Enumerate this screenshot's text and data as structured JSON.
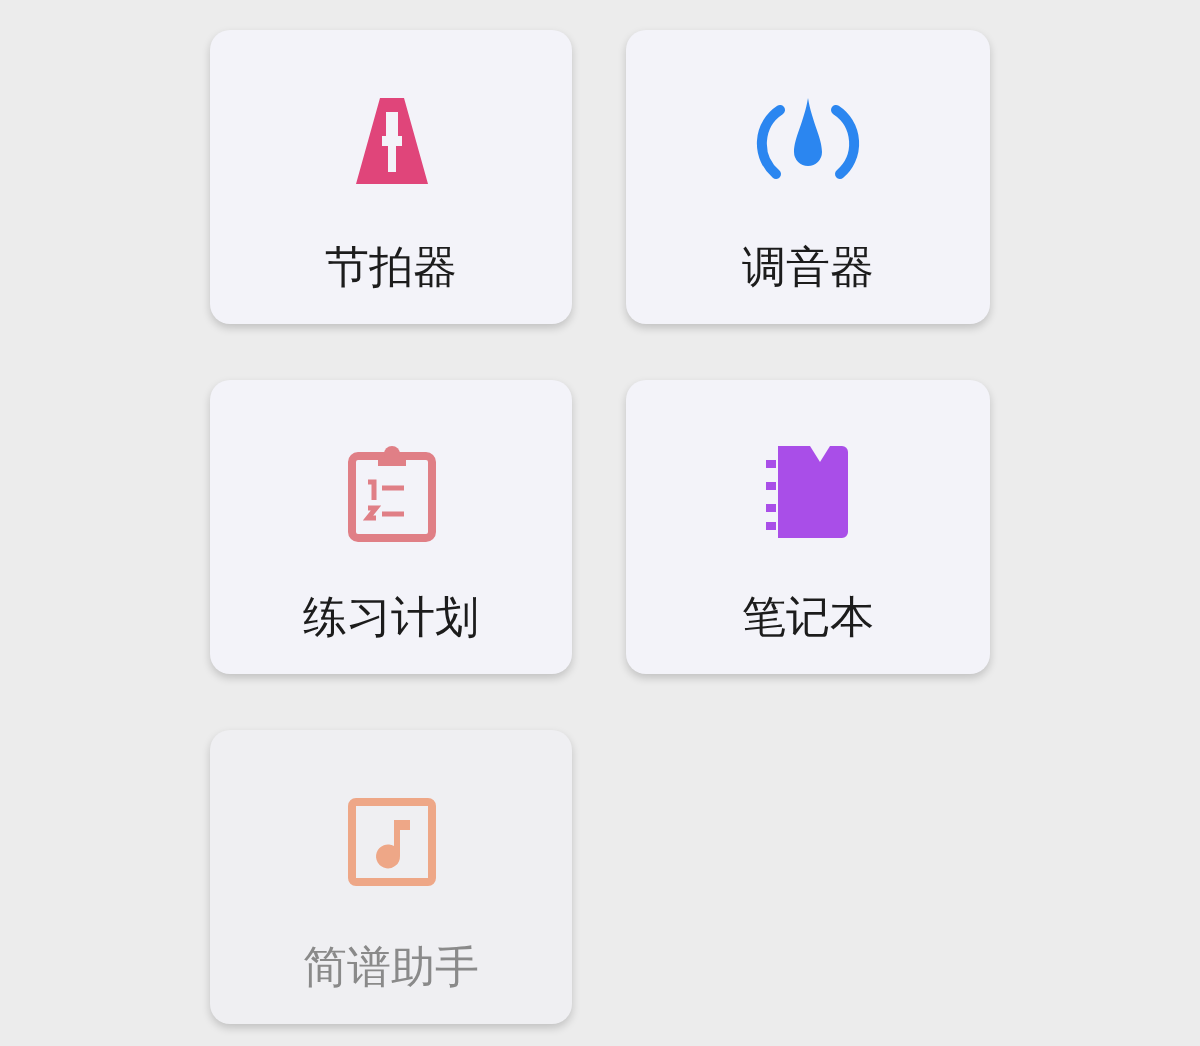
{
  "tools": [
    {
      "kind": "metronome",
      "label": "节拍器",
      "color": "#e0457a",
      "disabled": false
    },
    {
      "kind": "tuner",
      "label": "调音器",
      "color": "#2b86f0",
      "disabled": false
    },
    {
      "kind": "plan",
      "label": "练习计划",
      "color": "#e07f86",
      "disabled": false
    },
    {
      "kind": "notebook",
      "label": "笔记本",
      "color": "#a94ee8",
      "disabled": false
    },
    {
      "kind": "score",
      "label": "简谱助手",
      "color": "#eea07c",
      "disabled": true
    }
  ]
}
